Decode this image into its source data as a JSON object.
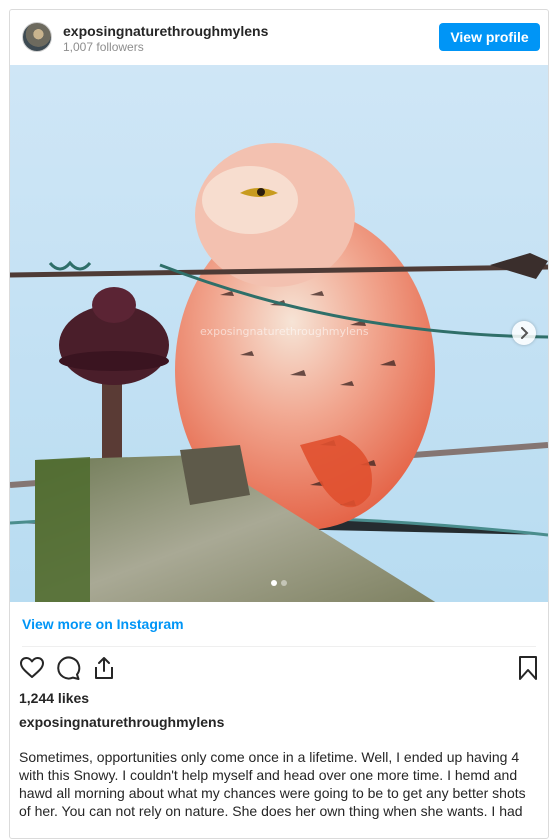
{
  "post": {
    "username": "exposingnaturethroughmylens",
    "followers": "1,007 followers",
    "view_profile_label": "View profile",
    "view_more_label": "View more on Instagram",
    "likes": "1,244 likes",
    "caption_username": "exposingnaturethroughmylens",
    "caption_text": "Sometimes, opportunities only come once in a lifetime. Well, I ended up having 4 with this Snowy. I couldn't help myself and head over one more time. I hemd and hawd all morning about what my chances were going to be to get any better shots of her. You can not rely on nature. She does her own thing when she wants. I had",
    "watermark": "exposingnaturethroughmylens",
    "carousel": {
      "total": 2,
      "active": 0
    }
  },
  "icons": {
    "avatar": "avatar",
    "next": "chevron-right-icon",
    "like": "heart-icon",
    "comment": "comment-icon",
    "share": "share-icon",
    "save": "bookmark-icon"
  },
  "colors": {
    "accent": "#0095f6",
    "border": "#dbdbdb",
    "muted": "#8e8e8e",
    "text": "#262626"
  }
}
